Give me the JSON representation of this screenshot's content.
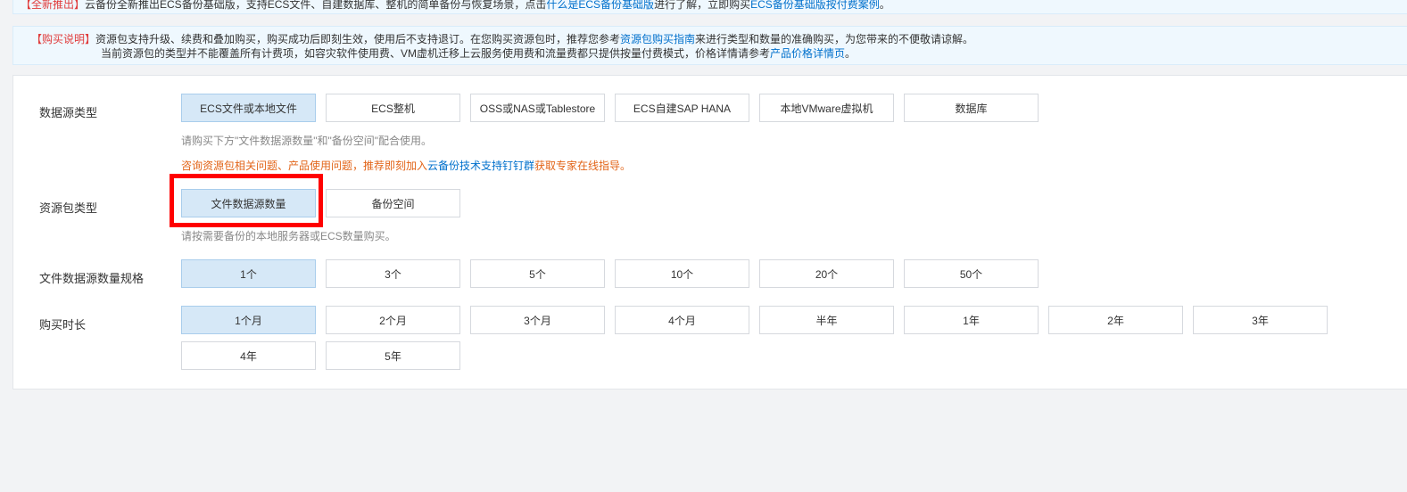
{
  "notice_top": {
    "tag": "【全新推出】",
    "text1": "云备份全新推出ECS备份基础版，支持ECS文件、自建数据库、整机的简单备份与恢复场景，点击",
    "link1": "什么是ECS备份基础版",
    "text2": "进行了解，立即购买",
    "link2": "ECS备份基础版按付费案例",
    "text3": "。"
  },
  "notice_main": {
    "tag": "【购买说明】",
    "line1_a": "资源包支持升级、续费和叠加购买，购买成功后即刻生效，使用后不支持退订。在您购买资源包时，推荐您参考",
    "line1_link": "资源包购买指南",
    "line1_b": "来进行类型和数量的准确购买，为您带来的不便敬请谅解。",
    "line2_a": "当前资源包的类型并不能覆盖所有计费项，如容灾软件使用费、VM虚机迁移上云服务使用费和流量费都只提供按量付费模式，价格详情请参考",
    "line2_link": "产品价格详情页",
    "line2_b": "。"
  },
  "datasource": {
    "label": "数据源类型",
    "options": [
      "ECS文件或本地文件",
      "ECS整机",
      "OSS或NAS或Tablestore",
      "ECS自建SAP HANA",
      "本地VMware虚拟机",
      "数据库"
    ],
    "hint": "请购买下方\"文件数据源数量\"和\"备份空间\"配合使用。",
    "consult_a": "咨询资源包相关问题、产品使用问题，推荐即刻加入",
    "consult_link": "云备份技术支持钉钉群",
    "consult_b": "获取专家在线指导。"
  },
  "package": {
    "label": "资源包类型",
    "options": [
      "文件数据源数量",
      "备份空间"
    ],
    "hint": "请按需要备份的本地服务器或ECS数量购买。"
  },
  "spec": {
    "label": "文件数据源数量规格",
    "options": [
      "1个",
      "3个",
      "5个",
      "10个",
      "20个",
      "50个"
    ]
  },
  "duration": {
    "label": "购买时长",
    "options": [
      "1个月",
      "2个月",
      "3个月",
      "4个月",
      "半年",
      "1年",
      "2年",
      "3年",
      "4年",
      "5年"
    ]
  },
  "colors": {
    "selected_bg": "#d6e8f7",
    "link": "#0070cc",
    "warning": "#e26418",
    "highlight": "#ff0000"
  }
}
